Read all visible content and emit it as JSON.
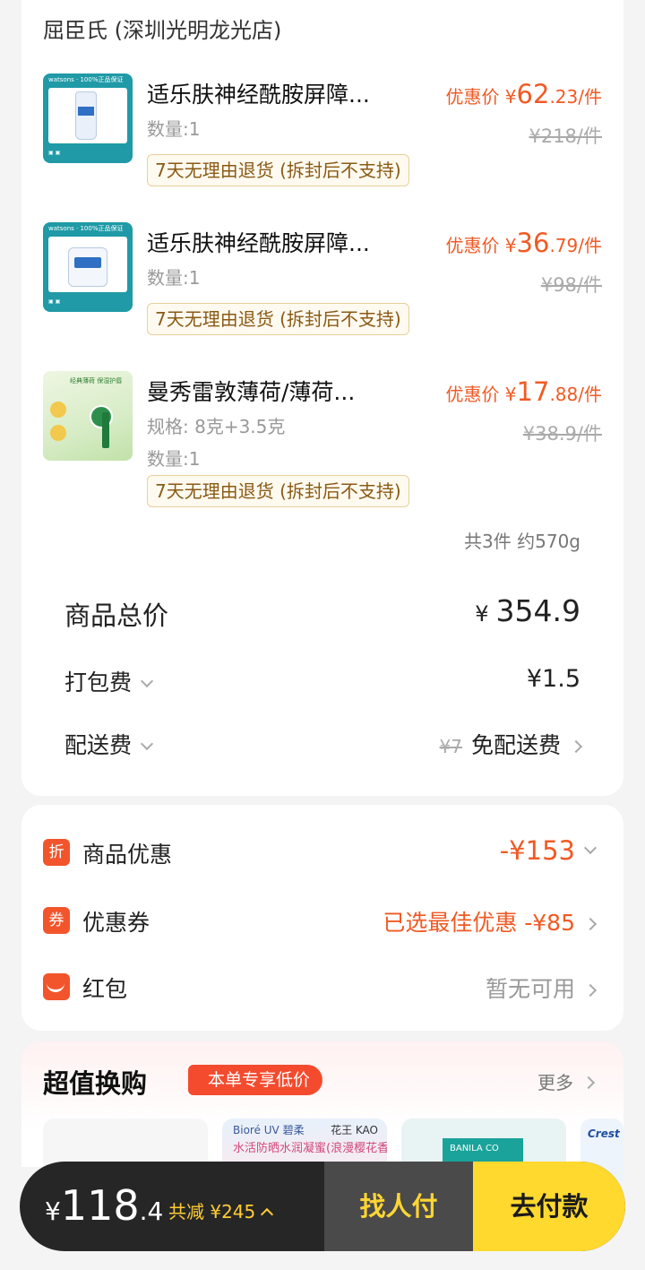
{
  "store": {
    "name": "屈臣氏 (深圳光明龙光店)"
  },
  "items": [
    {
      "name": "适乐肤神经酰胺屏障...",
      "qty": "数量:1",
      "return_tag": "7天无理由退货 (拆封后不支持)",
      "price_prefix": "优惠价 ¥",
      "price_int": "62",
      "price_dec": ".23/件",
      "orig_price": "¥218/件",
      "thumb_brand": "watsons",
      "thumb_badge": "100%正品保证"
    },
    {
      "name": "适乐肤神经酰胺屏障...",
      "qty": "数量:1",
      "return_tag": "7天无理由退货 (拆封后不支持)",
      "price_prefix": "优惠价 ¥",
      "price_int": "36",
      "price_dec": ".79/件",
      "orig_price": "¥98/件",
      "thumb_brand": "watsons",
      "thumb_badge": "100%正品保证"
    },
    {
      "name": "曼秀雷敦薄荷/薄荷...",
      "spec": "规格: 8克+3.5克",
      "qty": "数量:1",
      "return_tag": "7天无理由退货 (拆封后不支持)",
      "price_prefix": "优惠价 ¥",
      "price_int": "17",
      "price_dec": ".88/件",
      "orig_price": "¥38.9/件",
      "thumb_title": "经典薄荷 保湿护唇"
    }
  ],
  "summary": {
    "count": "共3件 约570g",
    "total_label": "商品总价",
    "total_value": "354.9",
    "currency": "¥",
    "packing_label": "打包费",
    "packing_value": "¥1.5",
    "delivery_label": "配送费",
    "delivery_orig": "¥7",
    "delivery_value": "免配送费"
  },
  "discounts": {
    "product_icon": "折",
    "product_label": "商品优惠",
    "product_value": "-¥153",
    "coupon_icon": "券",
    "coupon_label": "优惠券",
    "coupon_value": "已选最佳优惠 -¥85",
    "redpacket_label": "红包",
    "redpacket_value": "暂无可用"
  },
  "promo": {
    "title": "超值换购",
    "badge": "本单专享低价",
    "more": "更多",
    "products": [
      {
        "t1": "",
        "t2": ""
      },
      {
        "t1": "Bioré UV 碧柔",
        "t2": "水活防晒水润凝蜜(浪漫樱花香)",
        "t3": "花王 KAO"
      },
      {
        "t1": "BANILA CO",
        "t2": ""
      },
      {
        "t1": "Crest",
        "t2": ""
      }
    ]
  },
  "footer": {
    "currency": "¥",
    "amount_int": "118",
    "amount_dec": ".4",
    "saved": "共减 ¥245",
    "friend_pay": "找人付",
    "pay": "去付款"
  },
  "colors": {
    "accent": "#f05a24",
    "pay_button": "#ffd92e",
    "friend_button": "#4a4a4a",
    "bar": "#262626"
  }
}
